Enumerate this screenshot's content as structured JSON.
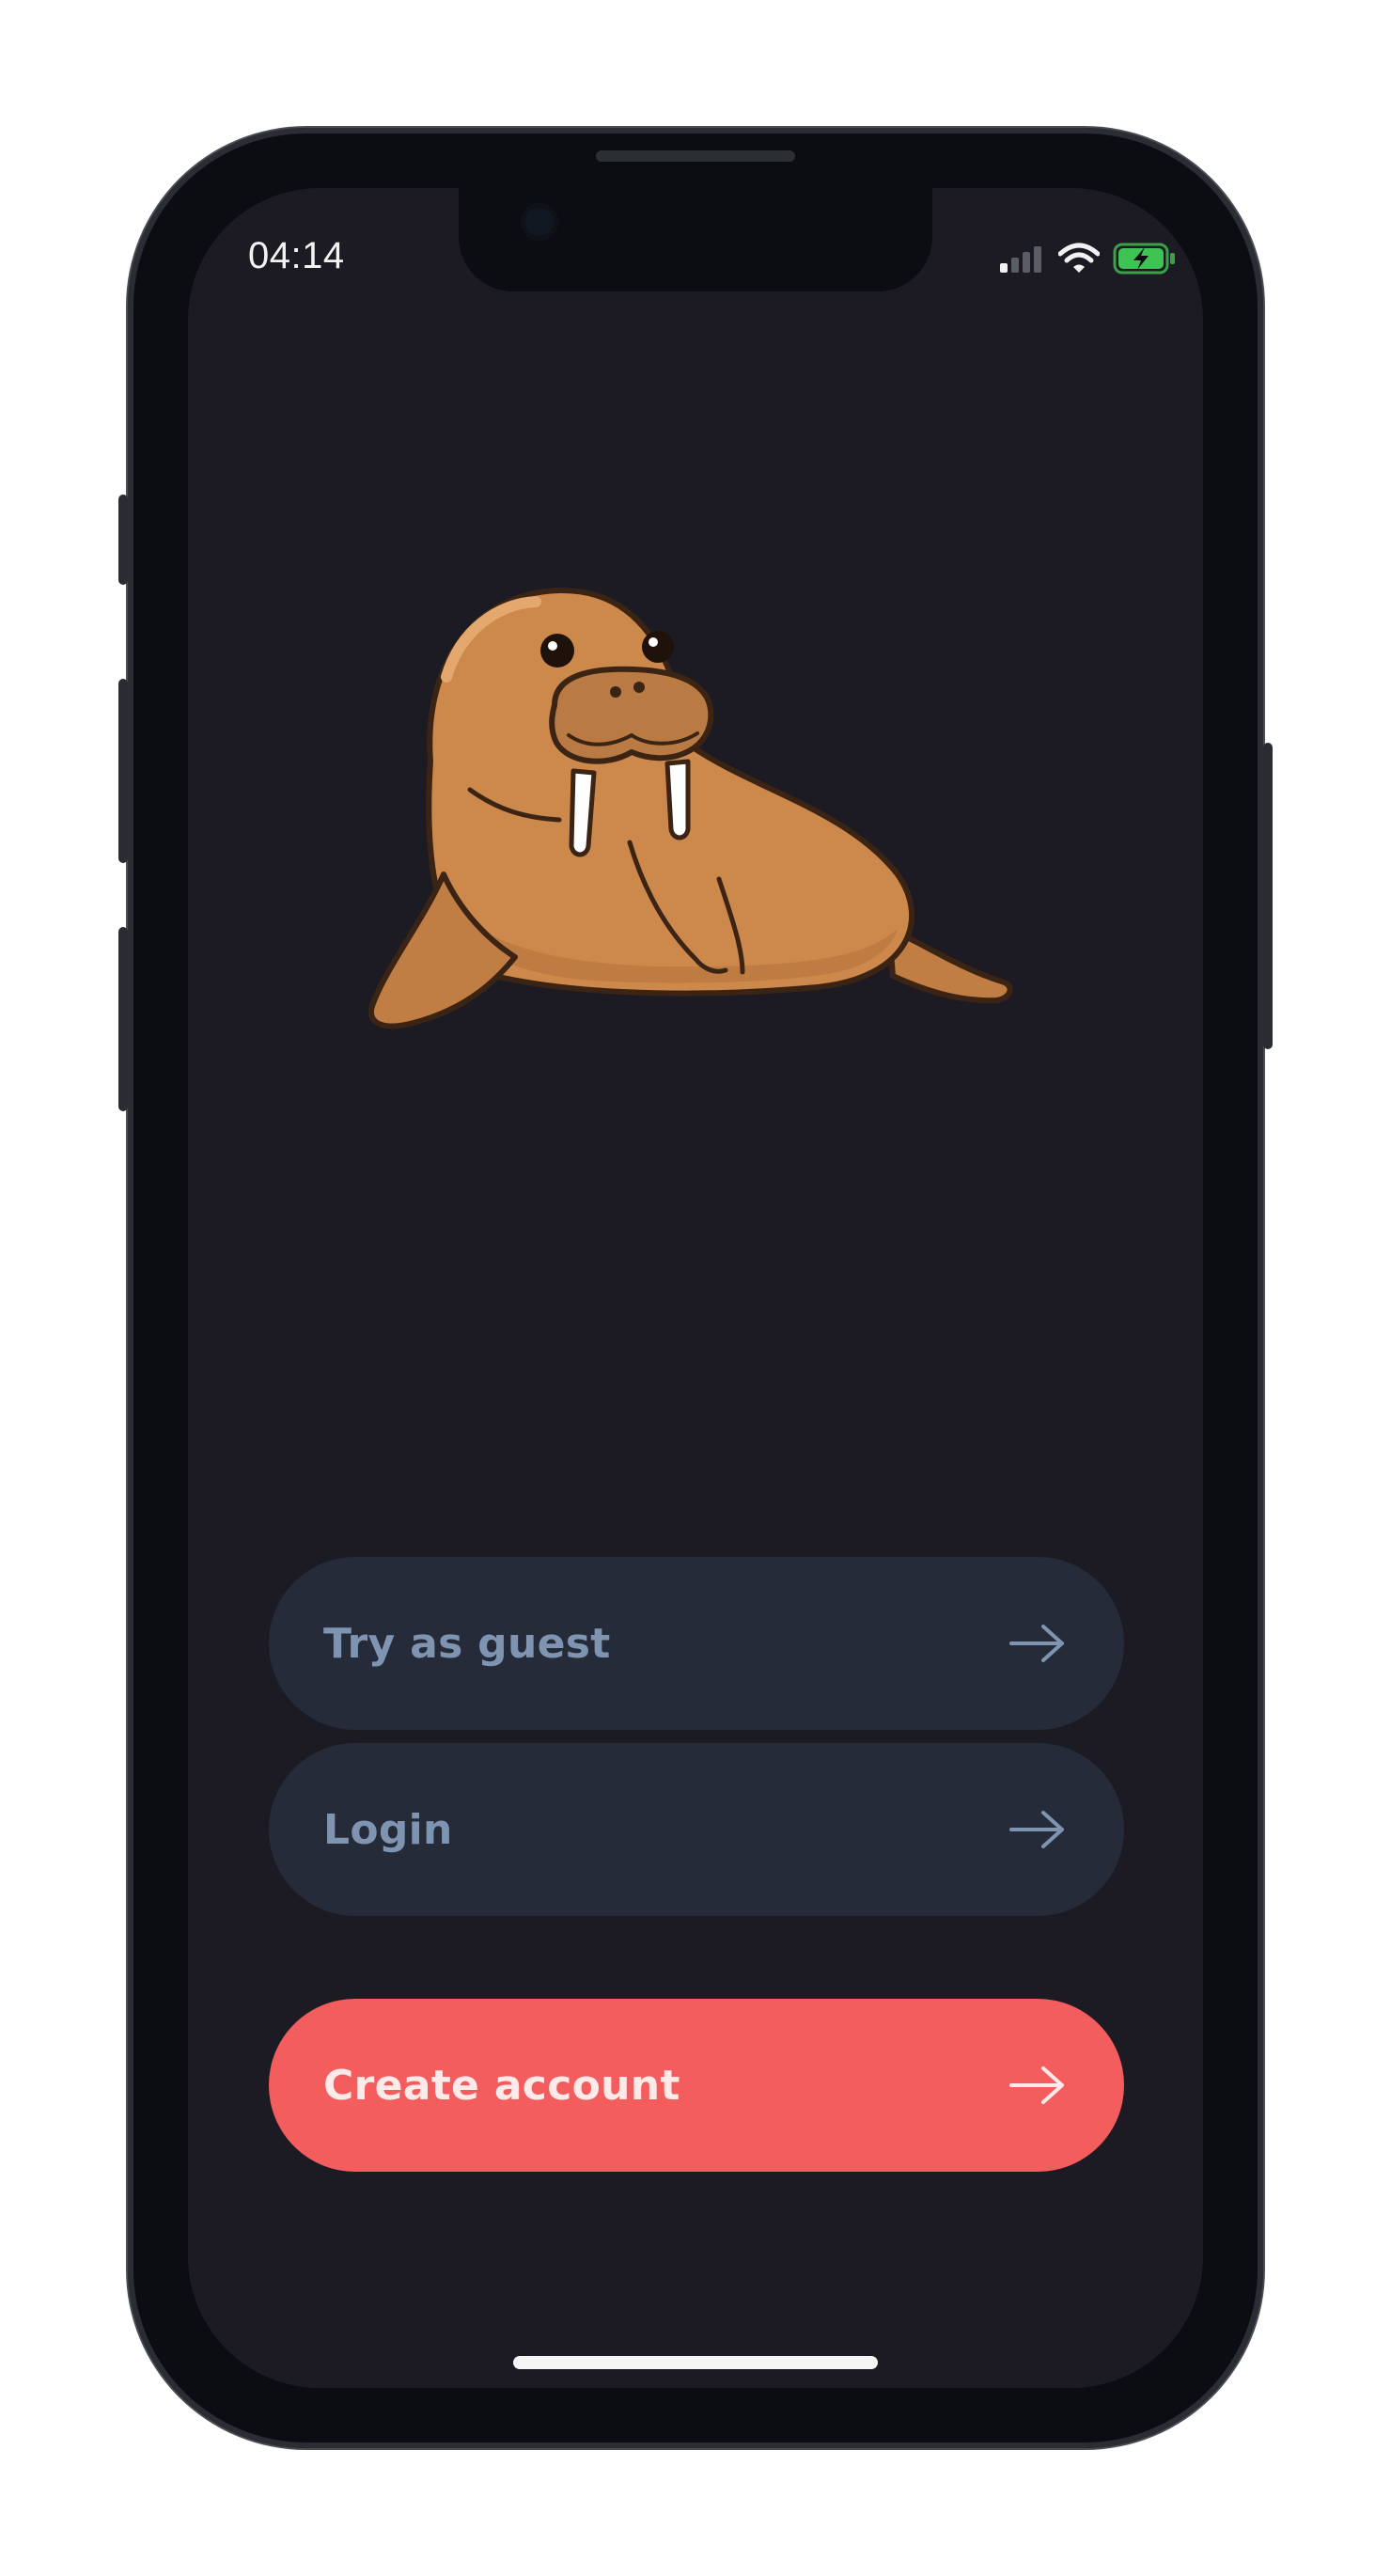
{
  "status_bar": {
    "time": "04:14",
    "icons": [
      "signal-icon",
      "wifi-icon",
      "battery-charging-icon"
    ]
  },
  "illustration": {
    "name": "walrus-mascot-icon"
  },
  "buttons": {
    "guest": {
      "label": "Try as guest",
      "icon": "arrow-right-icon"
    },
    "login": {
      "label": "Login",
      "icon": "arrow-right-icon"
    },
    "create": {
      "label": "Create account",
      "icon": "arrow-right-icon"
    }
  },
  "colors": {
    "background": "#1c1b23",
    "secondary_button": "#262b39",
    "secondary_text": "#7f94b1",
    "primary_button": "#f45d5e",
    "primary_text": "#ffeaea",
    "walrus_body": "#cd884c"
  }
}
